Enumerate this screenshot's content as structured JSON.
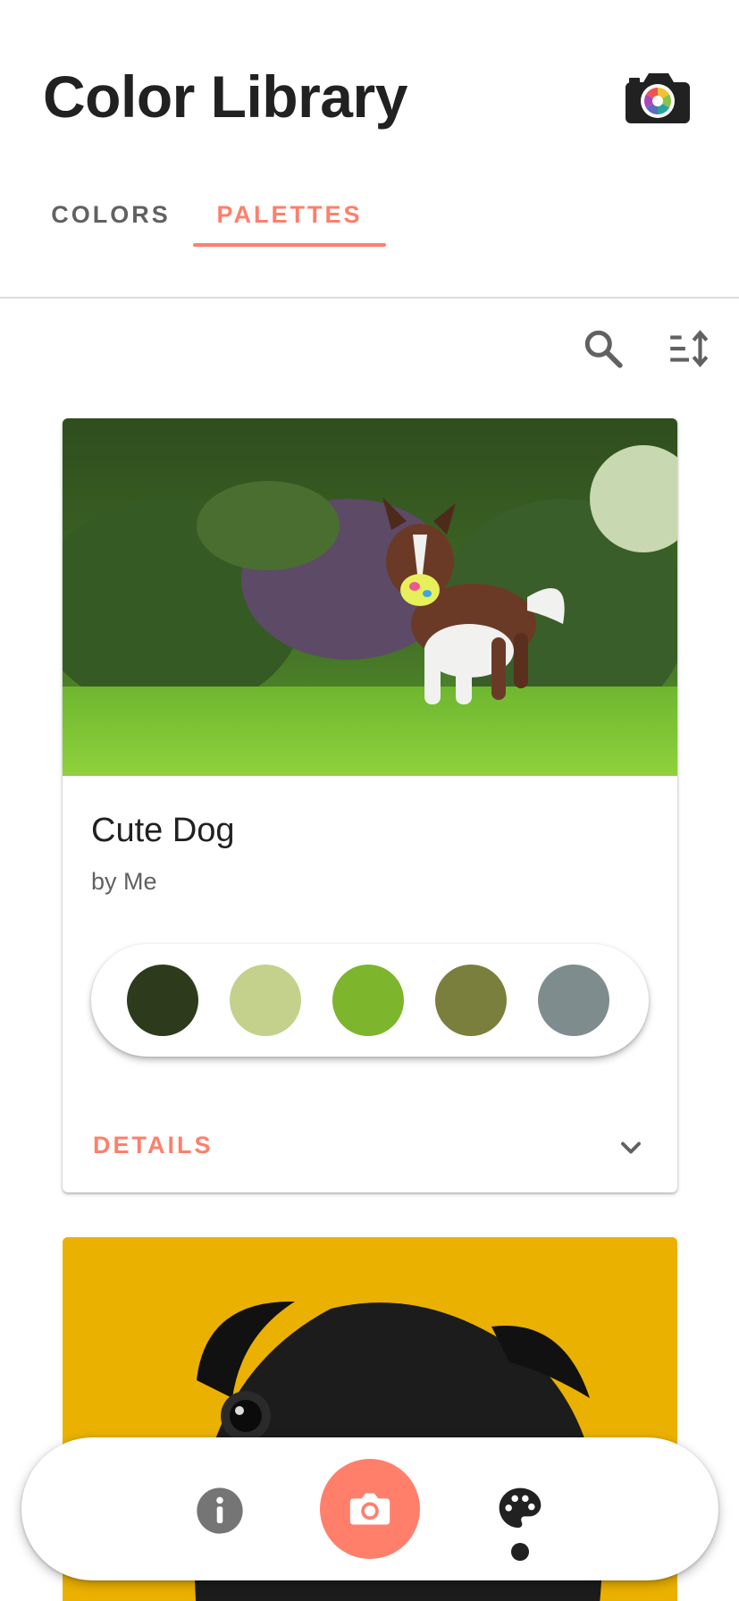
{
  "header": {
    "title": "Color Library"
  },
  "tabs": [
    {
      "label": "COLORS",
      "active": false
    },
    {
      "label": "PALETTES",
      "active": true
    }
  ],
  "toolbar": {
    "search_icon": "search-icon",
    "sort_icon": "sort-icon"
  },
  "palette_card": {
    "title": "Cute Dog",
    "author": "by Me",
    "details_label": "DETAILS",
    "swatches": [
      "#2d3b1c",
      "#c3d18c",
      "#7db52c",
      "#7a7f3d",
      "#7e8c8e"
    ]
  },
  "second_card": {
    "background": "#ebb100"
  },
  "bottom_nav": {
    "items": [
      "info-icon",
      "camera-icon",
      "palette-icon"
    ],
    "active": "palette-icon"
  },
  "colors": {
    "accent": "#ff7f6b",
    "text_primary": "#212121",
    "text_secondary": "#616161"
  }
}
